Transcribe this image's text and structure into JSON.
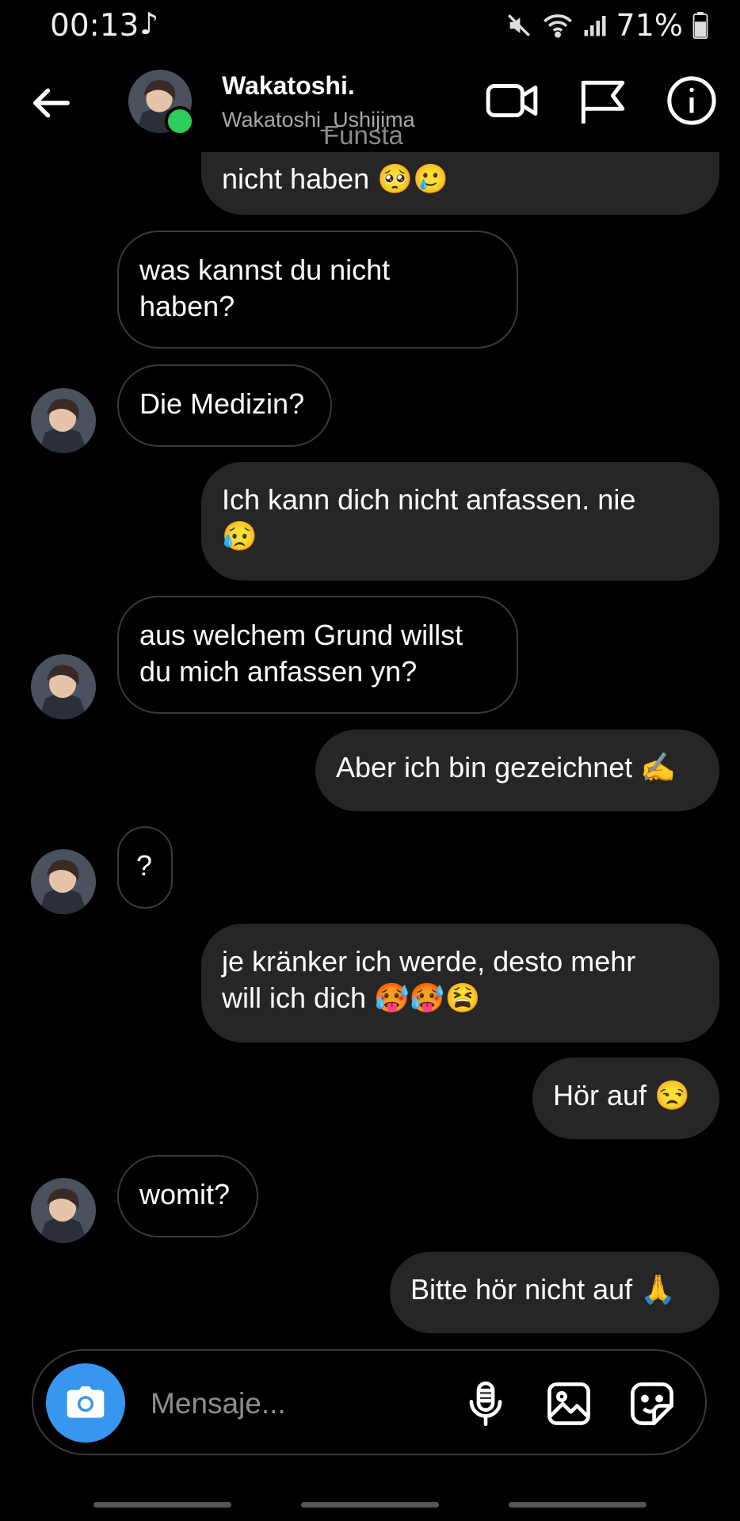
{
  "status": {
    "time": "00:13",
    "battery": "71%"
  },
  "header": {
    "name": "Wakatoshi.",
    "username": "Wakatoshi_Ushijima",
    "watermark": "Funsta"
  },
  "messages": [
    {
      "side": "out",
      "text": "nicht haben 🥺🥲"
    },
    {
      "side": "in",
      "text": "was kannst du nicht\nhaben?"
    },
    {
      "side": "in",
      "text": "Die Medizin?"
    },
    {
      "side": "out",
      "text": "Ich kann dich nicht anfassen. nie\n😥"
    },
    {
      "side": "in",
      "text": "aus welchem Grund willst\ndu mich anfassen yn?"
    },
    {
      "side": "out",
      "text": "Aber ich bin gezeichnet ✍️"
    },
    {
      "side": "in",
      "text": "?"
    },
    {
      "side": "out",
      "text": "je kränker ich werde, desto mehr\nwill ich dich 🥵🥵😫"
    },
    {
      "side": "out",
      "text": "Hör auf 😒"
    },
    {
      "side": "in",
      "text": "womit?"
    },
    {
      "side": "out",
      "text": "Bitte hör nicht auf 🙏"
    }
  ],
  "composer": {
    "placeholder": "Mensaje..."
  },
  "icons": {
    "back": "arrow-left-icon",
    "video": "video-camera-icon",
    "flag": "flag-icon",
    "info": "info-icon",
    "camera": "camera-icon",
    "mic": "microphone-icon",
    "gallery": "image-icon",
    "sticker": "sticker-icon"
  },
  "colors": {
    "background": "#000000",
    "outgoing_bubble": "#262626",
    "camera_button": "#3797f0",
    "online": "#2ecc5a"
  }
}
